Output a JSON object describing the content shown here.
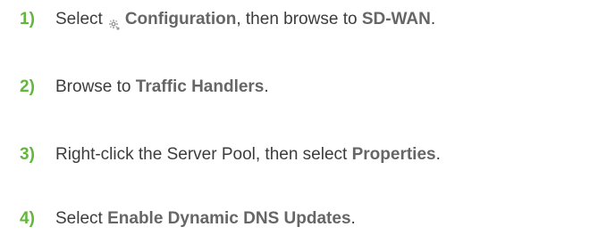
{
  "steps": [
    {
      "number": "1)",
      "parts": {
        "a": "Select",
        "b": "Configuration",
        "c": ", then browse to ",
        "d": "SD-WAN",
        "e": "."
      },
      "icon": "gear-icon"
    },
    {
      "number": "2)",
      "parts": {
        "a": "Browse to ",
        "b": "Traffic Handlers",
        "c": "."
      }
    },
    {
      "number": "3)",
      "parts": {
        "a": "Right-click the Server Pool, then select ",
        "b": "Properties",
        "c": "."
      }
    },
    {
      "number": "4)",
      "parts": {
        "a": "Select ",
        "b": "Enable Dynamic DNS Updates",
        "c": "."
      }
    }
  ],
  "colors": {
    "number": "#62b73b",
    "text": "#3c3c3c",
    "ui_term": "#666666",
    "icon": "#9a9a9a"
  }
}
